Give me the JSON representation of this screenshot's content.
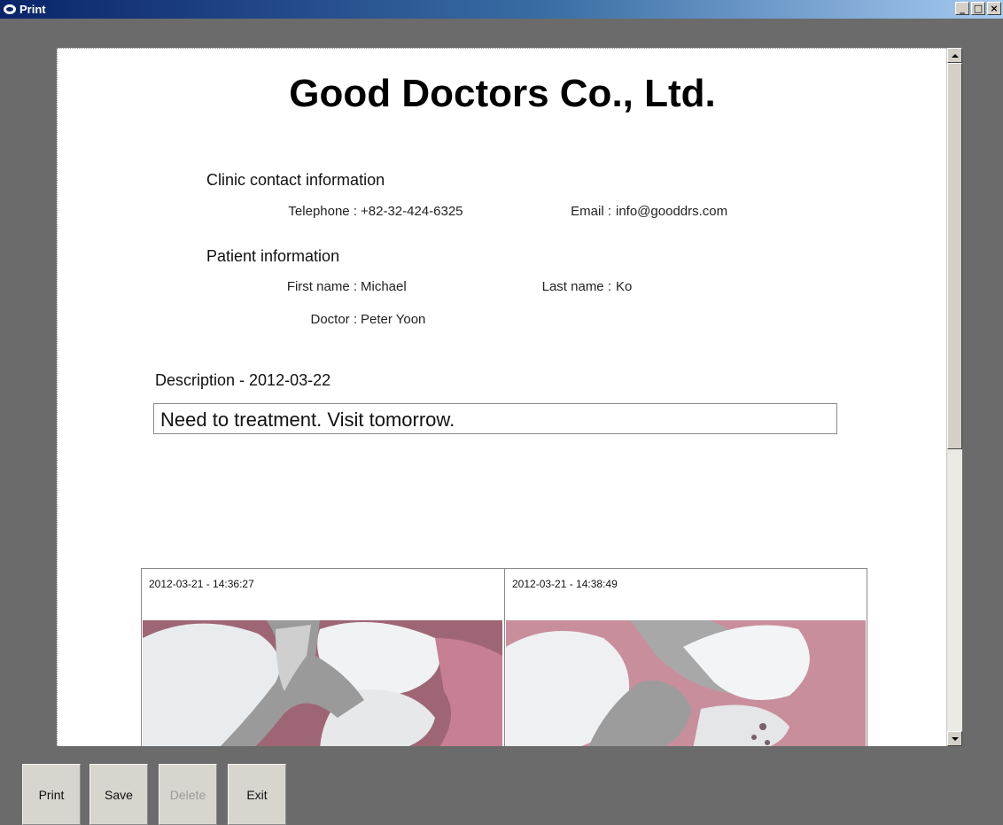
{
  "window": {
    "title": "Print",
    "minimize": "_",
    "maximize": "□",
    "close": "×"
  },
  "document": {
    "company": "Good Doctors Co., Ltd.",
    "clinic": {
      "heading": "Clinic contact information",
      "telephone_label": "Telephone :",
      "telephone": "+82-32-424-6325",
      "email_label": "Email :",
      "email": "info@gooddrs.com"
    },
    "patient": {
      "heading": "Patient information",
      "first_name_label": "First name :",
      "first_name": "Michael",
      "last_name_label": "Last name :",
      "last_name": "Ko",
      "doctor_label": "Doctor :",
      "doctor": "Peter Yoon"
    },
    "description": {
      "label": "Description - 2012-03-22",
      "text": "Need to treatment. Visit tomorrow."
    },
    "images": [
      {
        "caption": "2012-03-21 - 14:36:27"
      },
      {
        "caption": "2012-03-21 - 14:38:49"
      }
    ]
  },
  "buttons": {
    "print": "Print",
    "save": "Save",
    "delete": "Delete",
    "exit": "Exit"
  },
  "colors": {
    "title_bar": "#0a246a",
    "background": "#6b6b6b",
    "button_face": "#d8d5cf"
  }
}
